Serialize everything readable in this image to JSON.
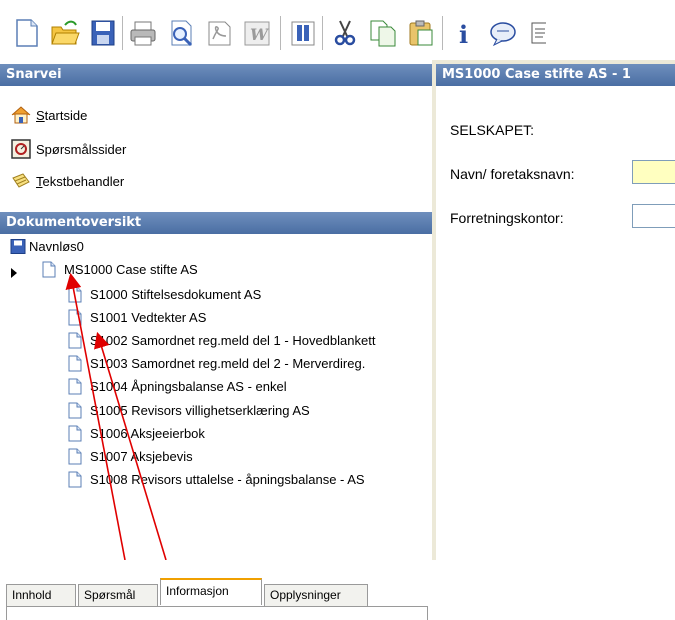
{
  "toolbar": {
    "buttons": [
      "new-document-icon",
      "open-folder-icon",
      "save-icon",
      "print-icon",
      "print-preview-icon",
      "pdf-icon",
      "word-icon",
      "book-icon",
      "cut-icon",
      "copy-icon",
      "paste-icon",
      "info-icon",
      "speech-bubble-icon",
      "edit-icon"
    ]
  },
  "shortcut_panel": {
    "title": "Snarvei",
    "items": [
      {
        "icon": "home-icon",
        "first": "S",
        "rest": "tartside"
      },
      {
        "icon": "questions-icon",
        "first": "",
        "rest": "Spørsmålssider"
      },
      {
        "icon": "text-editor-icon",
        "first": "T",
        "rest": "ekstbehandler"
      }
    ]
  },
  "document_panel": {
    "title": "Dokumentoversikt",
    "root": "Navnløs0",
    "case": "MS1000 Case stifte AS",
    "documents": [
      "S1000 Stiftelsesdokument AS",
      "S1001 Vedtekter AS",
      "S1002 Samordnet reg.meld del 1 - Hovedblankett",
      "S1003 Samordnet reg.meld del 2 - Merverdireg.",
      "S1004 Åpningsbalanse AS - enkel",
      "S1005 Revisors villighetserklæring AS",
      "S1006 Aksjeeierbok",
      "S1007 Aksjebevis",
      "S1008 Revisors uttalelse - åpningsbalanse - AS"
    ]
  },
  "tabs": [
    "Innhold",
    "Spørsmål",
    "Informasjon",
    "Opplysninger"
  ],
  "active_tab": "Informasjon",
  "form_panel": {
    "title": "MS1000 Case stifte AS - 1",
    "section": "SELSKAPET:",
    "fields": [
      {
        "label": "Navn/ foretaksnavn:",
        "value": "",
        "color": "#ffffc0"
      },
      {
        "label": "Forretningskontor:",
        "value": "",
        "color": "#ffffff"
      }
    ]
  },
  "colors": {
    "header": "#4a6ea3",
    "accent_tab": "#f0a000",
    "annotation_arrow": "#e00000"
  }
}
